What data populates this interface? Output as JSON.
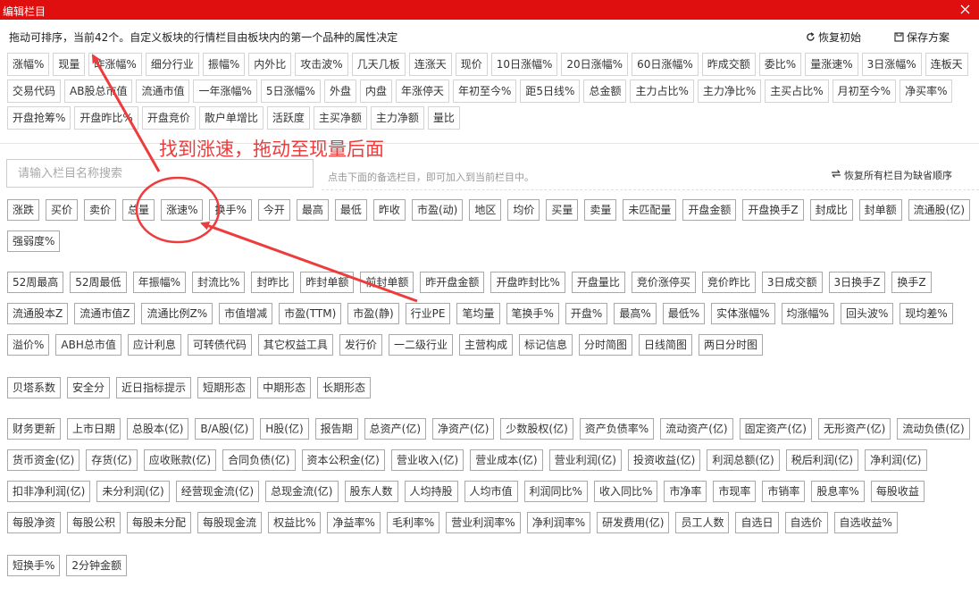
{
  "window": {
    "title": "编辑栏目",
    "close_icon": "close-icon"
  },
  "toolbar": {
    "hint": "拖动可排序，当前42个。自定义板块的行情栏目由板块内的第一个品种的属性决定",
    "reset_label": "恢复初始",
    "save_label": "保存方案"
  },
  "current_columns": [
    "涨幅%",
    "现量",
    "昨涨幅%",
    "细分行业",
    "振幅%",
    "内外比",
    "攻击波%",
    "几天几板",
    "连涨天",
    "现价",
    "10日涨幅%",
    "20日涨幅%",
    "60日涨幅%",
    "昨成交额",
    "委比%",
    "量涨速%",
    "3日涨幅%",
    "连板天",
    "交易代码",
    "AB股总市值",
    "流通市值",
    "一年涨幅%",
    "5日涨幅%",
    "外盘",
    "内盘",
    "年涨停天",
    "年初至今%",
    "距5日线%",
    "总金额",
    "主力占比%",
    "主力净比%",
    "主买占比%",
    "月初至今%",
    "净买率%",
    "开盘抢筹%",
    "开盘昨比%",
    "开盘竞价",
    "散户单增比",
    "活跃度",
    "主买净额",
    "主力净额",
    "量比"
  ],
  "search": {
    "placeholder": "请输入栏目名称搜索",
    "hint": "点击下面的备选栏目，即可加入到当前栏目中。",
    "restore_order_label": "恢复所有栏目为缺省顺序"
  },
  "available_groups": [
    [
      "涨跌",
      "买价",
      "卖价",
      "总量",
      "涨速%",
      "换手%",
      "今开",
      "最高",
      "最低",
      "昨收",
      "市盈(动)",
      "地区",
      "均价",
      "买量",
      "卖量",
      "未匹配量",
      "开盘金额",
      "开盘换手Z",
      "封成比",
      "封单额",
      "流通股(亿)",
      "强弱度%"
    ],
    [
      "52周最高",
      "52周最低",
      "年振幅%",
      "封流比%",
      "封昨比",
      "昨封单额",
      "前封单额",
      "昨开盘金额",
      "开盘昨封比%",
      "开盘量比",
      "竞价涨停买",
      "竞价昨比",
      "3日成交额",
      "3日换手Z",
      "换手Z",
      "流通股本Z",
      "流通市值Z",
      "流通比例Z%",
      "市值增减",
      "市盈(TTM)",
      "市盈(静)",
      "行业PE",
      "笔均量",
      "笔换手%",
      "开盘%",
      "最高%",
      "最低%",
      "实体涨幅%",
      "均涨幅%",
      "回头波%",
      "现均差%",
      "溢价%",
      "ABH总市值",
      "应计利息",
      "可转债代码",
      "其它权益工具",
      "发行价",
      "一二级行业",
      "主营构成",
      "标记信息",
      "分时简图",
      "日线简图",
      "两日分时图"
    ],
    [
      "贝塔系数",
      "安全分",
      "近日指标提示",
      "短期形态",
      "中期形态",
      "长期形态"
    ],
    [
      "财务更新",
      "上市日期",
      "总股本(亿)",
      "B/A股(亿)",
      "H股(亿)",
      "报告期",
      "总资产(亿)",
      "净资产(亿)",
      "少数股权(亿)",
      "资产负债率%",
      "流动资产(亿)",
      "固定资产(亿)",
      "无形资产(亿)",
      "流动负债(亿)",
      "货币资金(亿)",
      "存货(亿)",
      "应收账款(亿)",
      "合同负债(亿)",
      "资本公积金(亿)",
      "营业收入(亿)",
      "营业成本(亿)",
      "营业利润(亿)",
      "投资收益(亿)",
      "利润总额(亿)",
      "税后利润(亿)",
      "净利润(亿)",
      "扣非净利润(亿)",
      "未分利润(亿)",
      "经营现金流(亿)",
      "总现金流(亿)",
      "股东人数",
      "人均持股",
      "人均市值",
      "利润同比%",
      "收入同比%",
      "市净率",
      "市现率",
      "市销率",
      "股息率%",
      "每股收益",
      "每股净资",
      "每股公积",
      "每股未分配",
      "每股现金流",
      "权益比%",
      "净益率%",
      "毛利率%",
      "营业利润率%",
      "净利润率%",
      "研发费用(亿)",
      "员工人数",
      "自选日",
      "自选价",
      "自选收益%"
    ],
    [
      "短换手%",
      "2分钟金额"
    ]
  ],
  "annotation": {
    "text": "找到涨速，拖动至现量后面",
    "color": "#ee3b3b"
  },
  "colors": {
    "titlebar": "#e00f0f",
    "annotation": "#ee3b3b"
  }
}
